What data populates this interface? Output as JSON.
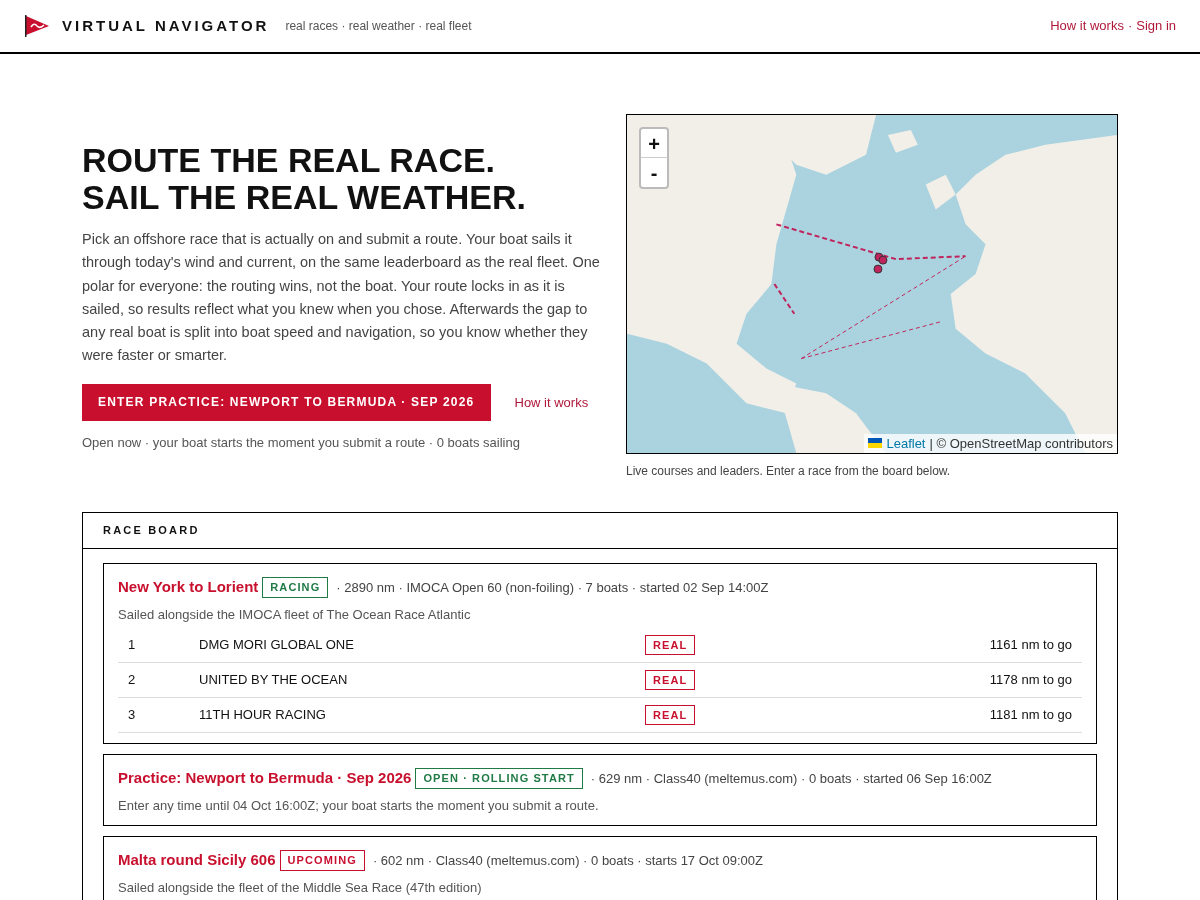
{
  "header": {
    "brand": "VIRTUAL NAVIGATOR",
    "tagline": "real races · real weather · real fleet",
    "links": [
      "How it works",
      "Sign in"
    ],
    "separator": "·"
  },
  "hero": {
    "headline": [
      "ROUTE THE REAL RACE.",
      "SAIL THE REAL WEATHER."
    ],
    "body": "Pick an offshore race that is actually on and submit a route. Your boat sails it through today's wind and current, on the same leaderboard as the real fleet. One polar for everyone: the routing wins, not the boat. Your route locks in as it is sailed, so results reflect what you knew when you chose. Afterwards the gap to any real boat is split into boat speed and navigation, so you know whether they were faster or smarter.",
    "cta": "ENTER PRACTICE: NEWPORT TO BERMUDA · SEP 2026",
    "secondary_link": "How it works",
    "note": "Open now · your boat starts the moment you submit a route · 0 boats sailing"
  },
  "map": {
    "zoom_in": "+",
    "zoom_out": "-",
    "attribution_link": "Leaflet",
    "attribution_text": "| © OpenStreetMap contributors",
    "caption": "Live courses and leaders. Enter a race from the board below."
  },
  "race_board": {
    "title": "RACE BOARD",
    "races": [
      {
        "name": "New York to Lorient",
        "status": "RACING",
        "color": "#1f7a45",
        "details": "· 2890 nm · IMOCA Open 60 (non-foiling) · 7 boats · started 02 Sep 14:00Z",
        "lines": [
          "Sailed alongside the IMOCA fleet of The Ocean Race Atlantic"
        ],
        "boats": [
          {
            "rank": "1",
            "name": "DMG MORI GLOBAL ONE",
            "tag": "REAL",
            "to_go": "1161 nm to go"
          },
          {
            "rank": "2",
            "name": "UNITED BY THE OCEAN",
            "tag": "REAL",
            "to_go": "1178 nm to go"
          },
          {
            "rank": "3",
            "name": "11TH HOUR RACING",
            "tag": "REAL",
            "to_go": "1181 nm to go"
          }
        ]
      },
      {
        "name": "Practice: Newport to Bermuda · Sep 2026",
        "status": "OPEN · ROLLING START",
        "color": "#1f7a45",
        "details": "· 629 nm · Class40 (meltemus.com) · 0 boats · started 06 Sep 16:00Z",
        "lines": [
          "Enter any time until 04 Oct 16:00Z; your boat starts the moment you submit a route."
        ]
      },
      {
        "name": "Malta round Sicily 606",
        "status": "UPCOMING",
        "color": "#c8102e",
        "details": "· 602 nm · Class40 (meltemus.com) · 0 boats · starts 17 Oct 09:00Z",
        "lines": [
          "Sailed alongside the fleet of the Middle Sea Race (47th edition)"
        ]
      }
    ]
  }
}
